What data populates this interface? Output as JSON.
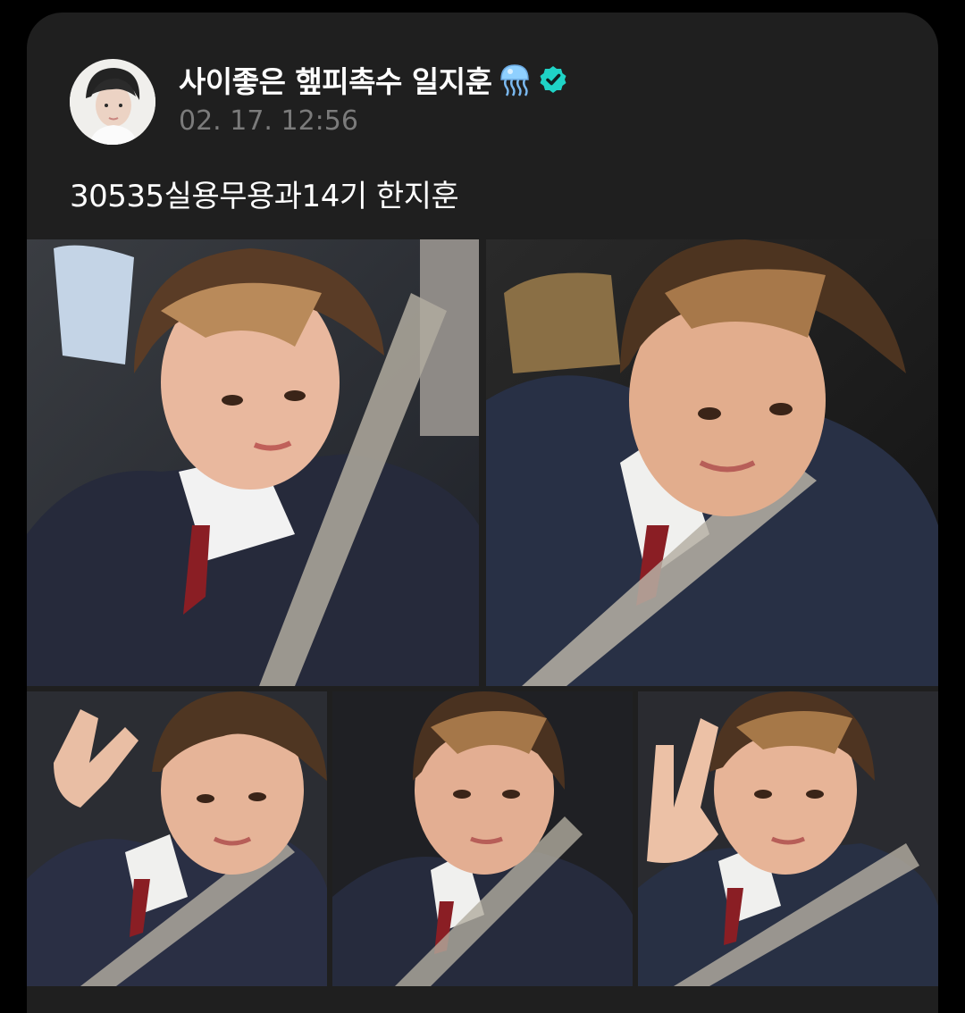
{
  "post": {
    "author_name": "사이좋은 햎피촉수 일지훈",
    "author_emoji": "jellyfish-emoji",
    "verified_icon": "verified-badge-icon",
    "timestamp": "02. 17. 12:56",
    "text": "30535실용무용과14기 한지훈"
  },
  "photos": [
    {
      "alt": "selfie-1"
    },
    {
      "alt": "selfie-2"
    },
    {
      "alt": "selfie-3"
    },
    {
      "alt": "selfie-4"
    },
    {
      "alt": "selfie-5"
    }
  ],
  "colors": {
    "background": "#000000",
    "card": "#1f1f1f",
    "text": "#ffffff",
    "timestamp": "#7b7b7b",
    "verified": "#1fd3c6"
  }
}
